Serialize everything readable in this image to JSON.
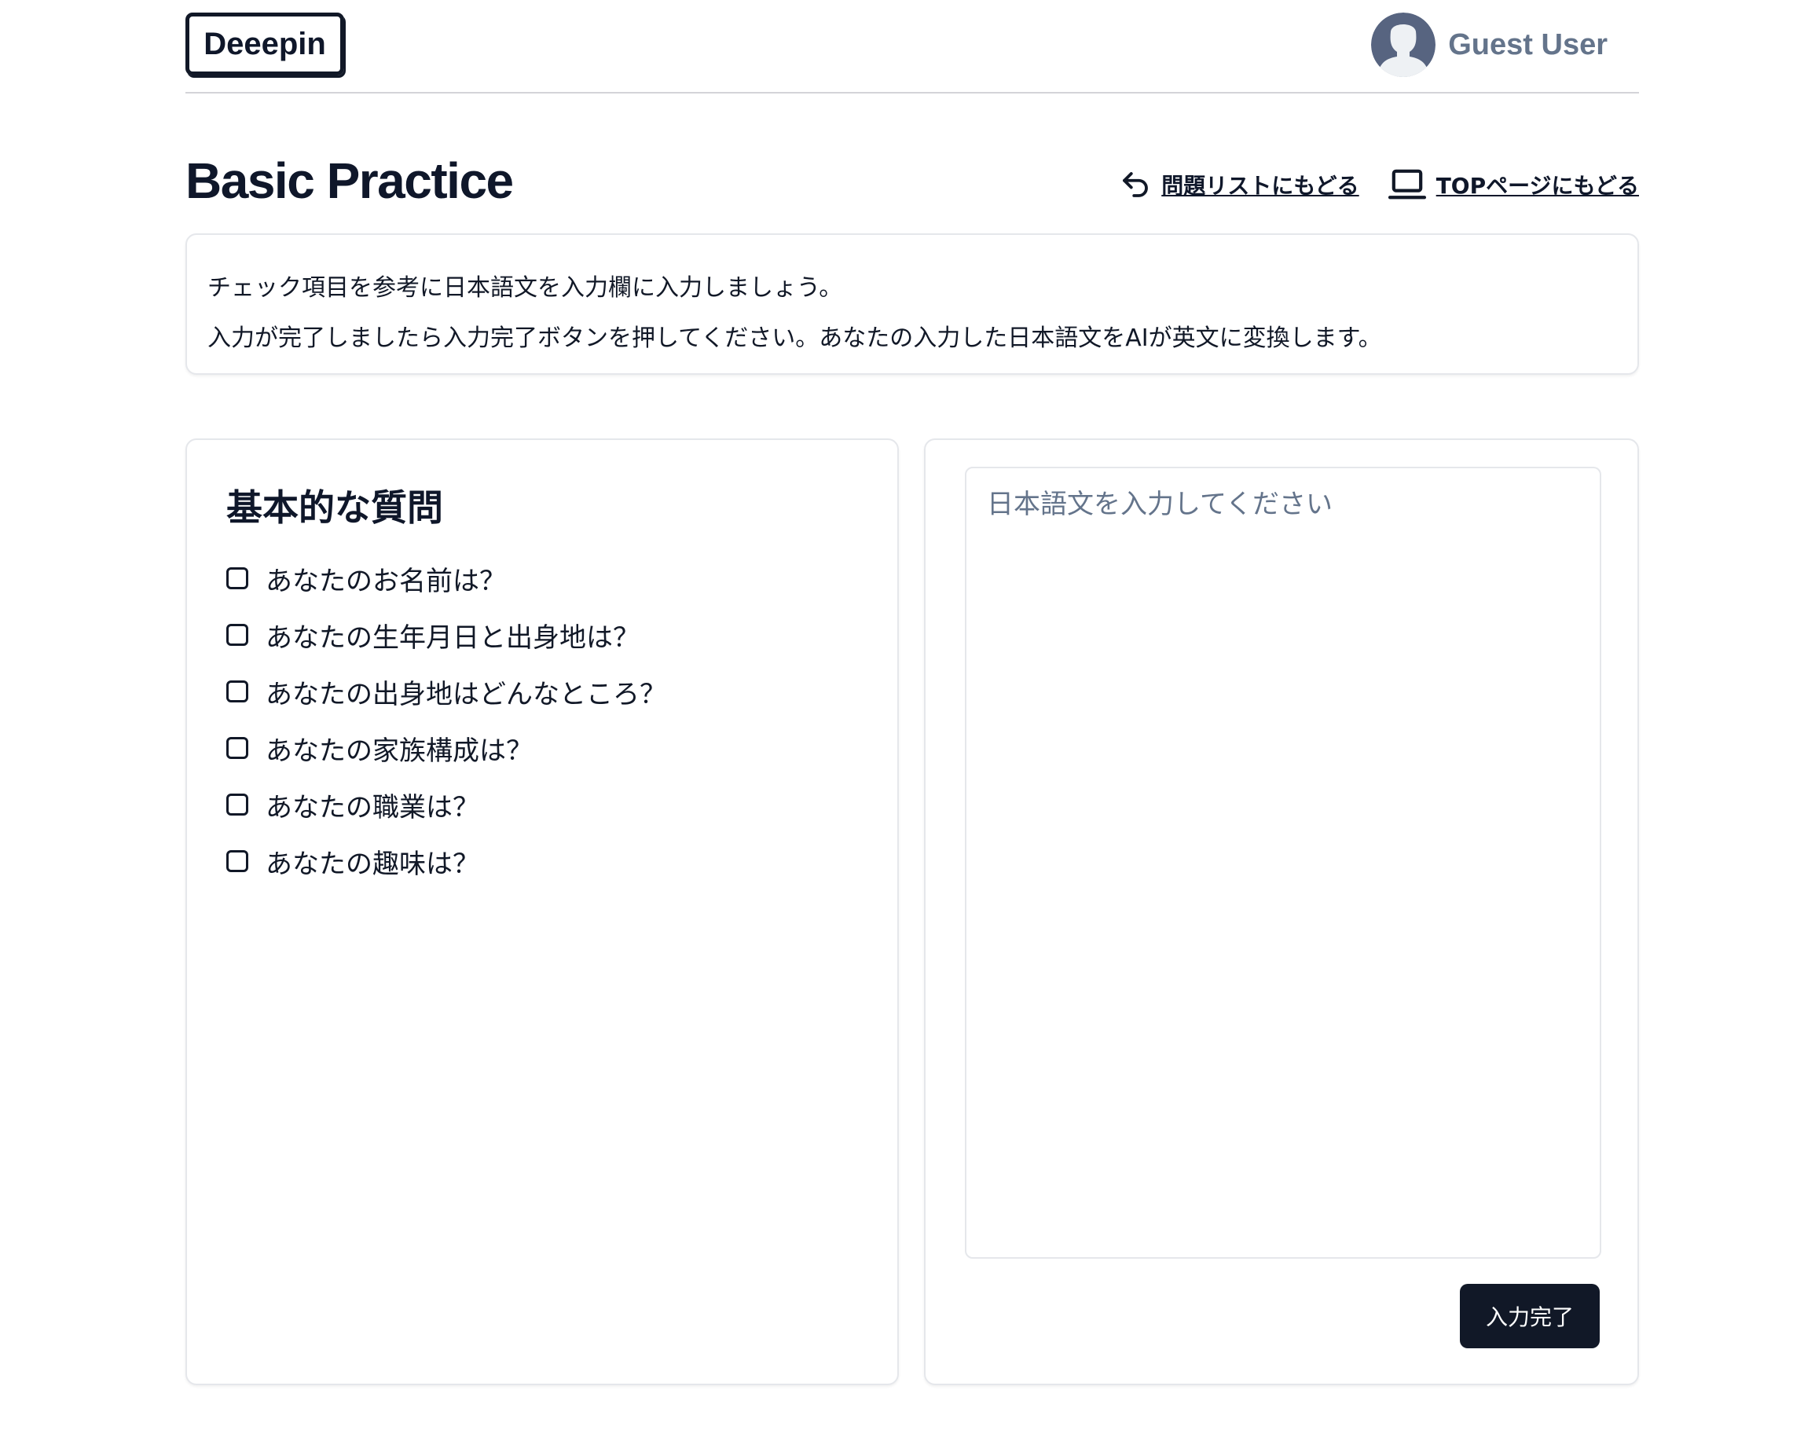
{
  "header": {
    "logo": "Deeepin",
    "user_name": "Guest User"
  },
  "page": {
    "title": "Basic Practice",
    "nav": {
      "back_to_list": "問題リストにもどる",
      "back_to_top": "TOPページにもどる"
    }
  },
  "instructions": {
    "line1": "チェック項目を参考に日本語文を入力欄に入力しましょう。",
    "line2": "入力が完了しましたら入力完了ボタンを押してください。あなたの入力した日本語文をAIが英文に変換します。"
  },
  "questions": {
    "title": "基本的な質問",
    "items": [
      {
        "label": "あなたのお名前は？",
        "checked": false
      },
      {
        "label": "あなたの生年月日と出身地は？",
        "checked": false
      },
      {
        "label": "あなたの出身地はどんなところ？",
        "checked": false
      },
      {
        "label": "あなたの家族構成は？",
        "checked": false
      },
      {
        "label": "あなたの職業は？",
        "checked": false
      },
      {
        "label": "あなたの趣味は？",
        "checked": false
      }
    ]
  },
  "editor": {
    "placeholder": "日本語文を入力してください",
    "value": "",
    "submit_label": "入力完了"
  },
  "icons": {
    "undo": "undo-arrow-icon",
    "laptop": "laptop-icon",
    "avatar": "user-avatar-icon"
  },
  "colors": {
    "text": "#0f172a",
    "muted": "#64748b",
    "button_bg": "#111827",
    "border": "#e5e7eb",
    "avatar_bg": "#576480"
  }
}
